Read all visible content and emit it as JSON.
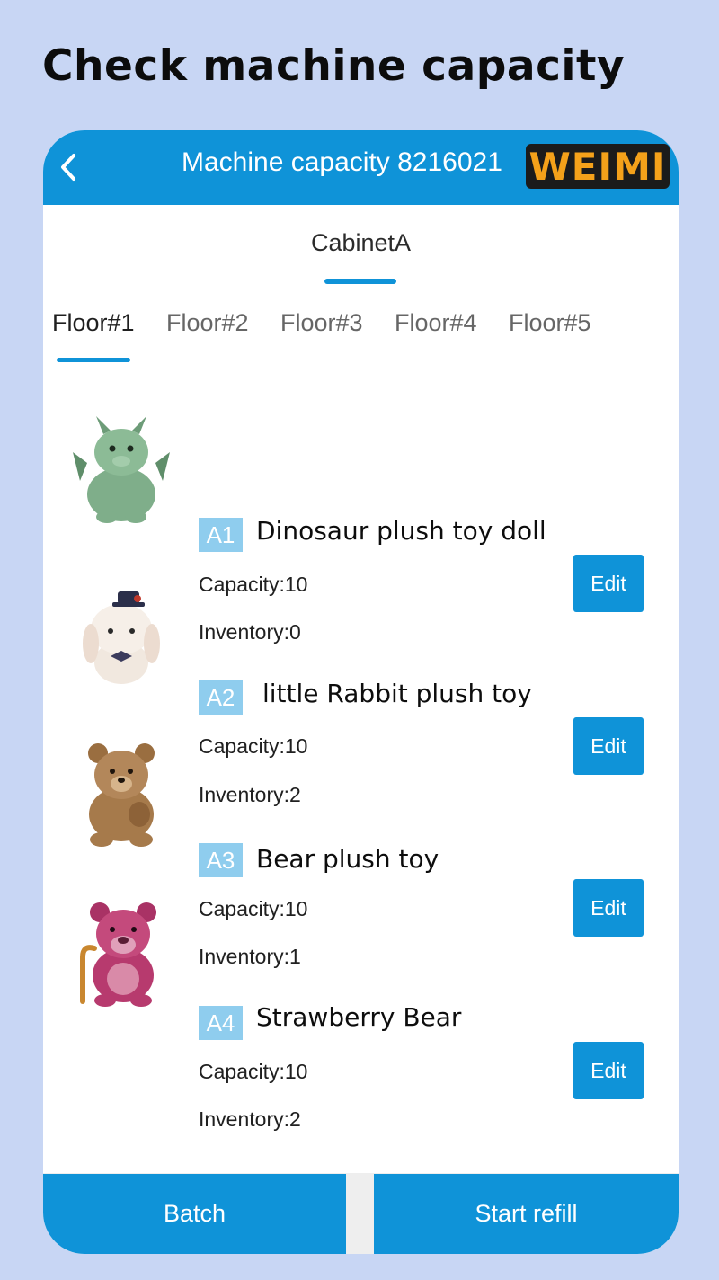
{
  "promo": {
    "title": "Check machine capacity"
  },
  "header": {
    "title": "Machine capacity 8216021",
    "brand": "WEIMI"
  },
  "cabinet_tab": "CabinetA",
  "floor_tabs": [
    "Floor#1",
    "Floor#2",
    "Floor#3",
    "Floor#4",
    "Floor#5"
  ],
  "active_floor": "Floor#1",
  "products": [
    {
      "slot": "A1",
      "name": "Dinosaur plush toy doll",
      "capacity": "Capacity:10",
      "inventory": "Inventory:0",
      "edit": "Edit",
      "image": "green-dragon-plush"
    },
    {
      "slot": "A2",
      "name": "little Rabbit plush toy",
      "capacity": "Capacity:10",
      "inventory": "Inventory:2",
      "edit": "Edit",
      "image": "white-rabbit-plush"
    },
    {
      "slot": "A3",
      "name": "Bear plush toy",
      "capacity": "Capacity:10",
      "inventory": "Inventory:1",
      "edit": "Edit",
      "image": "brown-teddy-bear"
    },
    {
      "slot": "A4",
      "name": "Strawberry Bear",
      "capacity": "Capacity:10",
      "inventory": "Inventory:2",
      "edit": "Edit",
      "image": "pink-strawberry-bear"
    }
  ],
  "footer": {
    "batch": "Batch",
    "start_refill": "Start refill"
  },
  "colors": {
    "primary": "#0f93d8",
    "badge": "#8fcdee",
    "background": "#c8d6f4",
    "brand_text": "#f4a11a"
  }
}
